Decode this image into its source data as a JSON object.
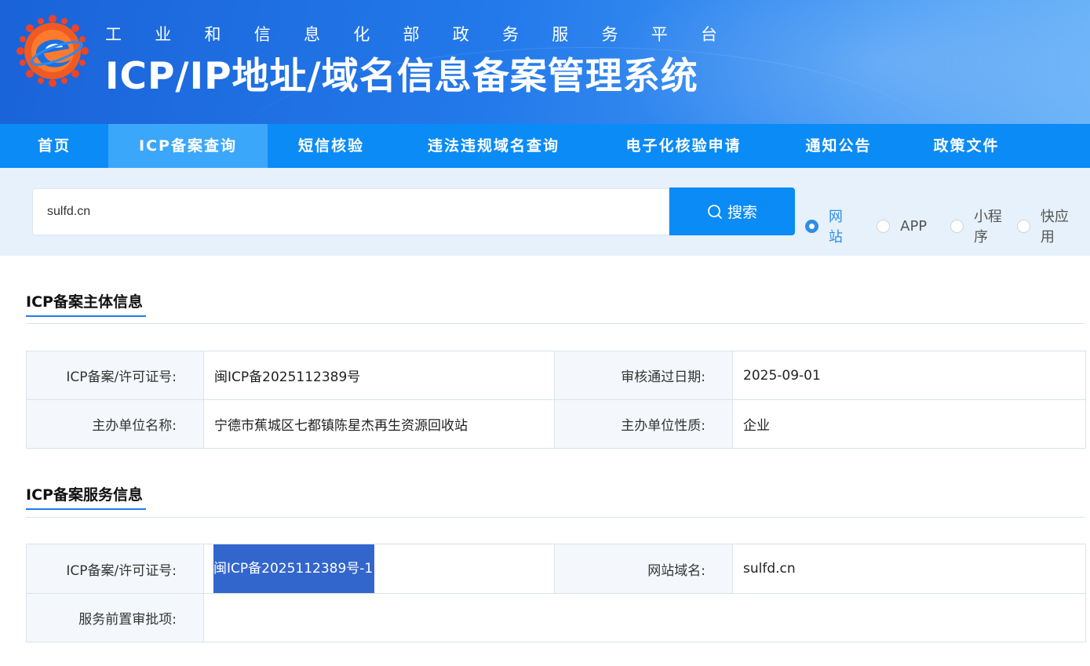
{
  "header": {
    "subtitle_chars": [
      "工",
      "业",
      "和",
      "信",
      "息",
      "化",
      "部",
      "政",
      "务",
      "服",
      "务",
      "平",
      "台"
    ],
    "title": "ICP/IP地址/域名信息备案管理系统"
  },
  "nav": {
    "items": [
      {
        "label": "首页"
      },
      {
        "label": "ICP备案查询"
      },
      {
        "label": "短信核验"
      },
      {
        "label": "违法违规域名查询"
      },
      {
        "label": "电子化核验申请"
      },
      {
        "label": "通知公告"
      },
      {
        "label": "政策文件"
      }
    ],
    "active_index": 1
  },
  "search": {
    "value": "sulfd.cn",
    "button_label": "搜索",
    "options": [
      "网站",
      "APP",
      "小程序",
      "快应用"
    ],
    "selected_option": "网站"
  },
  "subject_info": {
    "section_title": "ICP备案主体信息",
    "rows": [
      [
        {
          "label": "ICP备案/许可证号:",
          "value": "闽ICP备2025112389号"
        },
        {
          "label": "审核通过日期:",
          "value": "2025-09-01"
        }
      ],
      [
        {
          "label": "主办单位名称:",
          "value": "宁德市蕉城区七都镇陈星杰再生资源回收站"
        },
        {
          "label": "主办单位性质:",
          "value": "企业"
        }
      ]
    ]
  },
  "service_info": {
    "section_title": "ICP备案服务信息",
    "license_label": "ICP备案/许可证号:",
    "license_value": "闽ICP备2025112389号-1",
    "domain_label": "网站域名:",
    "domain_value": "sulfd.cn",
    "preapproval_label": "服务前置审批项:",
    "preapproval_value": ""
  },
  "colors": {
    "nav_bg": "#0a8bf6",
    "nav_active": "#3ba7fb",
    "accent": "#1c7de8",
    "selection": "#3366cc"
  }
}
